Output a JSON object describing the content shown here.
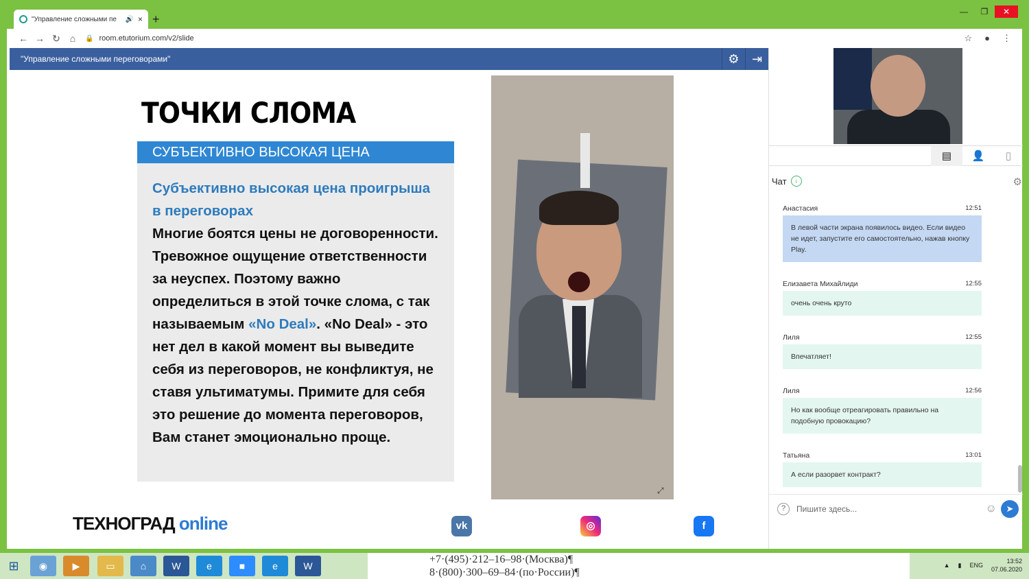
{
  "browser": {
    "tab_title": "\"Управление сложными пе",
    "url": "room.etutorium.com/v2/slide"
  },
  "app": {
    "header_title": "\"Управление сложными переговорами\""
  },
  "slide": {
    "title": "ТОЧКИ СЛОМА",
    "section": "СУБЪЕКТИВНО ВЫСОКАЯ ЦЕНА",
    "heading": "Субъективно высокая цена проигрыша в переговорах",
    "body_1": "Многие боятся цены не договоренности. Тревожное ощущение ответственности за неуспех. Поэтому важно определиться в этой точке слома, с так называемым",
    "body_highlight": "«No Deal»",
    "body_2": ". «No Deal» - это нет дел в какой момент вы выведите себя из переговоров, не конфликтуя, не ставя ультиматумы. Примите для себя это решение до момента переговоров, Вам станет эмоционально проще.",
    "logo_main": "ТЕХНОГРАД",
    "logo_sub": "online"
  },
  "chat": {
    "label": "Чат",
    "messages": [
      {
        "author": "Анастасия",
        "time": "12:51",
        "text": "В левой части экрана появилось видео. Если видео не идет, запустите его самостоятельно, нажав кнопку Play."
      },
      {
        "author": "Елизавета Михайлиди",
        "time": "12:55",
        "text": "очень очень круто"
      },
      {
        "author": "Лиля",
        "time": "12:55",
        "text": "Впечатляет!"
      },
      {
        "author": "Лиля",
        "time": "12:56",
        "text": "Но как вообще отреагировать правильно на подобную провокацию?"
      },
      {
        "author": "Татьяна",
        "time": "13:01",
        "text": "А если разорвет контракт?"
      }
    ],
    "placeholder": "Пишите здесь..."
  },
  "taskbar": {
    "doc_line_1": "+7·(495)·212–16–98·(Москва)¶",
    "doc_line_2": "8·(800)·300–69–84·(по·России)¶",
    "lang": "ENG",
    "time": "13:52",
    "date": "07.06.2020"
  }
}
